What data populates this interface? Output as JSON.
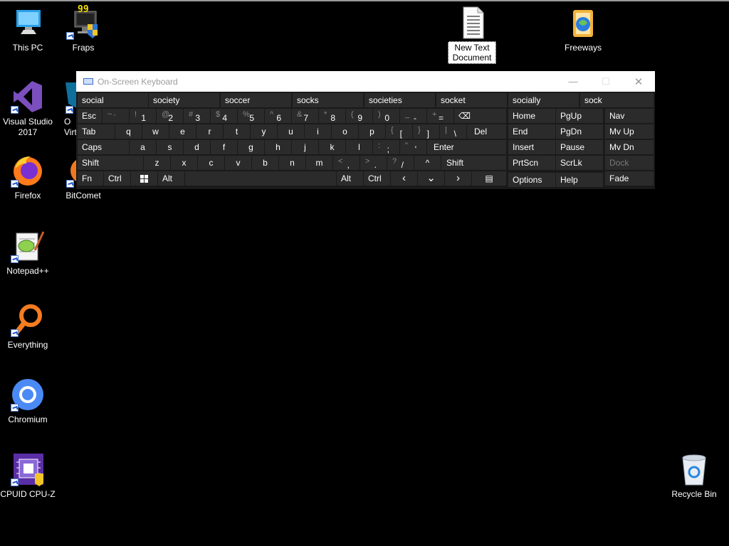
{
  "desktop": {
    "icons": [
      {
        "label": "This PC",
        "icon": "this-pc-icon"
      },
      {
        "label": "Fraps",
        "icon": "fraps-icon",
        "badge": "99"
      },
      {
        "label": "New Text Document",
        "icon": "text-document-icon"
      },
      {
        "label": "Freeways",
        "icon": "freeways-icon"
      },
      {
        "label": "Visual Studio 2017",
        "icon": "visual-studio-icon"
      },
      {
        "label": "O\nVirt",
        "icon": "virtualbox-icon"
      },
      {
        "label": "Firefox",
        "icon": "firefox-icon"
      },
      {
        "label": "BitComet",
        "icon": "bitcomet-icon"
      },
      {
        "label": "Notepad++",
        "icon": "notepadpp-icon"
      },
      {
        "label": "Everything",
        "icon": "everything-icon"
      },
      {
        "label": "Chromium",
        "icon": "chromium-icon"
      },
      {
        "label": "CPUID CPU-Z",
        "icon": "cpuz-icon"
      },
      {
        "label": "Recycle Bin",
        "icon": "recycle-bin-icon"
      }
    ]
  },
  "osk": {
    "title": "On-Screen Keyboard",
    "minimize": "—",
    "maximize": "☐",
    "close": "✕",
    "suggestions": [
      "social",
      "society",
      "soccer",
      "socks",
      "societies",
      "socket",
      "socially",
      "sock"
    ],
    "keys": {
      "esc": "Esc",
      "tilde_top": "~",
      "tilde_main": "`",
      "n1_top": "!",
      "n1": "1",
      "n2_top": "@",
      "n2": "2",
      "n3_top": "#",
      "n3": "3",
      "n4_top": "$",
      "n4": "4",
      "n5_top": "%",
      "n5": "5",
      "n6_top": "^",
      "n6": "6",
      "n7_top": "&",
      "n7": "7",
      "n8_top": "*",
      "n8": "8",
      "n9_top": "(",
      "n9": "9",
      "n0_top": ")",
      "n0": "0",
      "minus_top": "_",
      "minus": "-",
      "eq_top": "+",
      "eq": "=",
      "bksp": "⌫",
      "tab": "Tab",
      "q": "q",
      "w": "w",
      "e": "e",
      "r": "r",
      "t": "t",
      "y": "y",
      "u": "u",
      "i": "i",
      "o": "o",
      "p": "p",
      "lbr_top": "{",
      "lbr": "[",
      "rbr_top": "}",
      "rbr": "]",
      "pipe_top": "|",
      "bslash": "\\",
      "del": "Del",
      "caps": "Caps",
      "a": "a",
      "s": "s",
      "d": "d",
      "f": "f",
      "g": "g",
      "h": "h",
      "j": "j",
      "k": "k",
      "l": "l",
      "colon_top": ":",
      "semi": ";",
      "quote_top": "\"",
      "quote": "'",
      "enter": "Enter",
      "shift": "Shift",
      "z": "z",
      "x": "x",
      "c": "c",
      "v": "v",
      "b": "b",
      "n": "n",
      "m": "m",
      "lt_top": "<",
      "comma": ",",
      "gt_top": ">",
      "period": ".",
      "q_top": "?",
      "slash": "/",
      "up": "^",
      "shift_r": "Shift",
      "fn": "Fn",
      "ctrl": "Ctrl",
      "alt": "Alt",
      "alt_r": "Alt",
      "ctrl_r": "Ctrl",
      "left": "‹",
      "down": "⌄",
      "right": "›",
      "menu": "▤",
      "home": "Home",
      "pgup": "PgUp",
      "nav": "Nav",
      "end": "End",
      "pgdn": "PgDn",
      "mvup": "Mv Up",
      "insert": "Insert",
      "pause": "Pause",
      "mvdn": "Mv Dn",
      "prtscn": "PrtScn",
      "scrlk": "ScrLk",
      "dock": "Dock",
      "options": "Options",
      "help": "Help",
      "fade": "Fade"
    }
  }
}
